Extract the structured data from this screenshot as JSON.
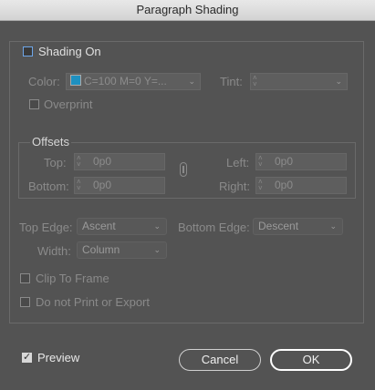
{
  "window": {
    "title": "Paragraph Shading"
  },
  "shading": {
    "label": "Shading On",
    "checked": false
  },
  "color": {
    "label": "Color:",
    "value": "C=100 M=0 Y=...",
    "swatch_color": "#1e90c0"
  },
  "tint": {
    "label": "Tint:",
    "value": ""
  },
  "overprint": {
    "label": "Overprint",
    "checked": false
  },
  "offsets": {
    "heading": "Offsets",
    "top_label": "Top:",
    "top_value": "0p0",
    "bottom_label": "Bottom:",
    "bottom_value": "0p0",
    "left_label": "Left:",
    "left_value": "0p0",
    "right_label": "Right:",
    "right_value": "0p0"
  },
  "top_edge": {
    "label": "Top Edge:",
    "value": "Ascent"
  },
  "bottom_edge": {
    "label": "Bottom Edge:",
    "value": "Descent"
  },
  "width": {
    "label": "Width:",
    "value": "Column"
  },
  "clip_to_frame": {
    "label": "Clip To Frame",
    "checked": false
  },
  "no_print": {
    "label": "Do not Print or Export",
    "checked": false
  },
  "preview": {
    "label": "Preview",
    "checked": true
  },
  "buttons": {
    "cancel": "Cancel",
    "ok": "OK"
  }
}
